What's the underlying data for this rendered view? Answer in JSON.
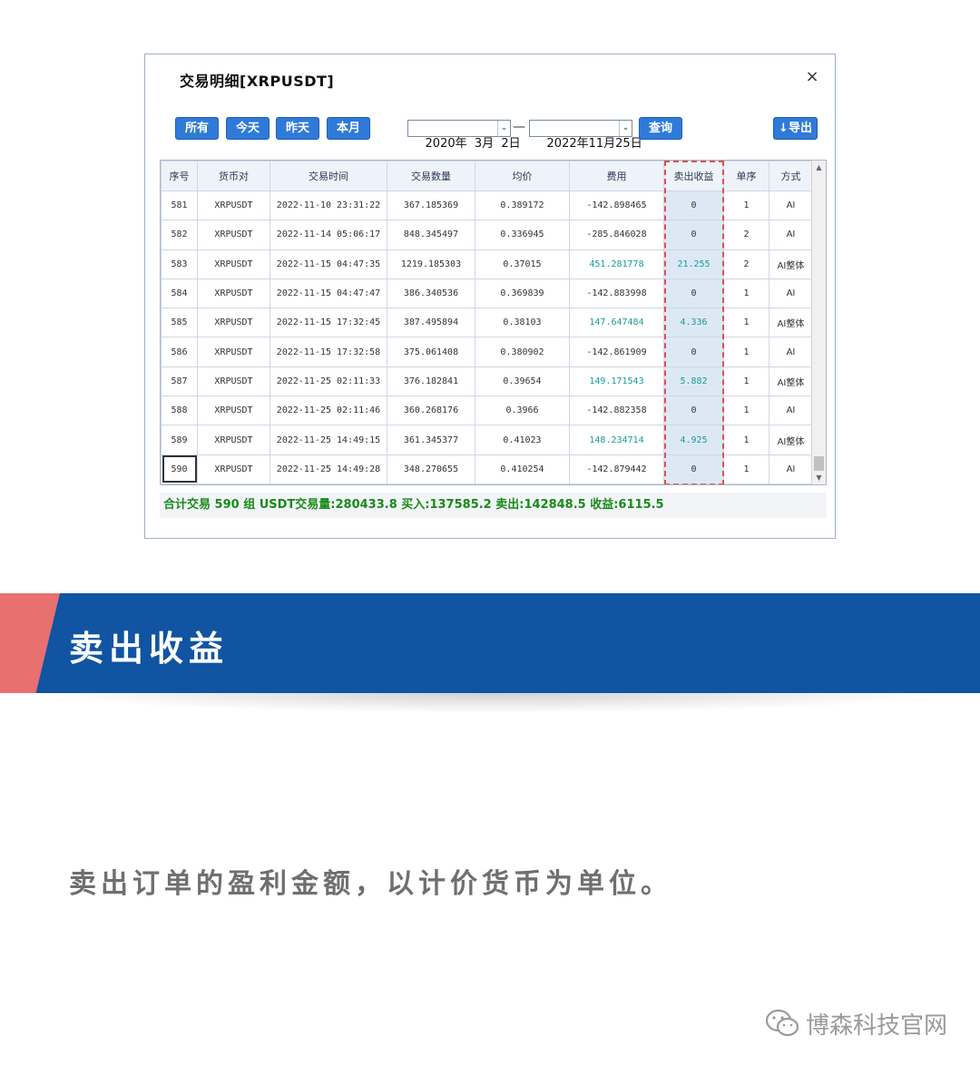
{
  "dialog": {
    "title": "交易明细[XRPUSDT]",
    "close_icon": "×",
    "buttons": {
      "all": "所有",
      "today": "今天",
      "yesterday": "昨天",
      "this_month": "本月",
      "query": "查询",
      "export": "↓导出"
    },
    "date_from": "2020年  3月  2日",
    "date_to": "2022年11月25日",
    "date_separator": "—",
    "dropdown_icon": "chevron-down",
    "table": {
      "headers": [
        "序号",
        "货币对",
        "交易时间",
        "交易数量",
        "均价",
        "费用",
        "卖出收益",
        "单序",
        "方式"
      ],
      "rows": [
        [
          "581",
          "XRPUSDT",
          "2022-11-10 23:31:22",
          "367.185369",
          "0.389172",
          "-142.898465",
          "0",
          "1",
          "AI"
        ],
        [
          "582",
          "XRPUSDT",
          "2022-11-14 05:06:17",
          "848.345497",
          "0.336945",
          "-285.846028",
          "0",
          "2",
          "AI"
        ],
        [
          "583",
          "XRPUSDT",
          "2022-11-15 04:47:35",
          "1219.185303",
          "0.37015",
          "451.281778",
          "21.255",
          "2",
          "AI整体"
        ],
        [
          "584",
          "XRPUSDT",
          "2022-11-15 04:47:47",
          "386.340536",
          "0.369839",
          "-142.883998",
          "0",
          "1",
          "AI"
        ],
        [
          "585",
          "XRPUSDT",
          "2022-11-15 17:32:45",
          "387.495894",
          "0.38103",
          "147.647484",
          "4.336",
          "1",
          "AI整体"
        ],
        [
          "586",
          "XRPUSDT",
          "2022-11-15 17:32:58",
          "375.061408",
          "0.380902",
          "-142.861909",
          "0",
          "1",
          "AI"
        ],
        [
          "587",
          "XRPUSDT",
          "2022-11-25 02:11:33",
          "376.182841",
          "0.39654",
          "149.171543",
          "5.882",
          "1",
          "AI整体"
        ],
        [
          "588",
          "XRPUSDT",
          "2022-11-25 02:11:46",
          "360.268176",
          "0.3966",
          "-142.882358",
          "0",
          "1",
          "AI"
        ],
        [
          "589",
          "XRPUSDT",
          "2022-11-25 14:49:15",
          "361.345377",
          "0.41023",
          "148.234714",
          "4.925",
          "1",
          "AI整体"
        ],
        [
          "590",
          "XRPUSDT",
          "2022-11-25 14:49:28",
          "348.270655",
          "0.410254",
          "-142.879442",
          "0",
          "1",
          "AI"
        ]
      ]
    },
    "summary": "合计交易 590 组   USDT交易量:280433.8  买入:137585.2  卖出:142848.5  收益:6115.5"
  },
  "banner": {
    "title": "卖出收益"
  },
  "description": "卖出订单的盈利金额，以计价货币为单位。",
  "watermark": "博森科技官网",
  "colors": {
    "banner_blue": "#1054a2",
    "banner_accent": "#e8706f",
    "button_blue": "#2f7ad9",
    "summary_green": "#1a8a1a",
    "profit_teal": "#1a9a9a",
    "highlight_red": "#d9534f"
  }
}
